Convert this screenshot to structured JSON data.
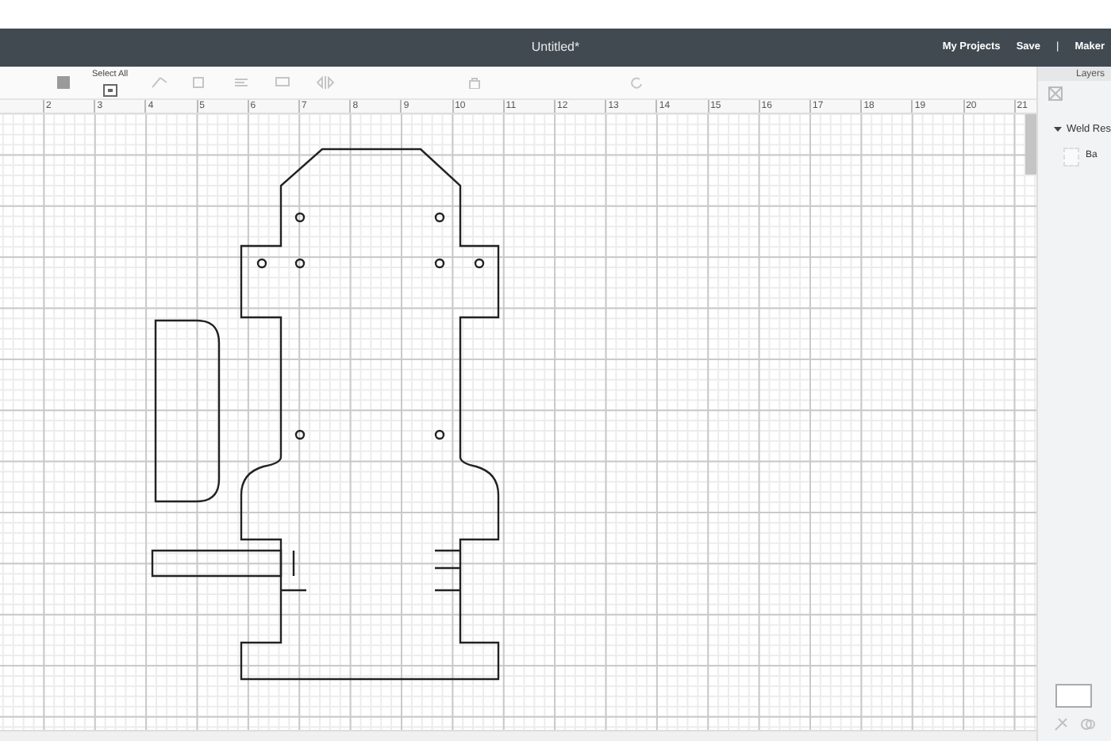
{
  "window": {
    "title": "Untitled*"
  },
  "header": {
    "items": [
      {
        "kind": "link",
        "label": "My Projects"
      },
      {
        "kind": "link",
        "label": "Save"
      },
      {
        "kind": "separator",
        "label": "|"
      },
      {
        "kind": "link",
        "label": "Maker"
      }
    ]
  },
  "toolbar": {
    "select_all": "Select All"
  },
  "ruler": {
    "labels": [
      "2",
      "3",
      "4",
      "5",
      "6",
      "7",
      "8",
      "9",
      "10",
      "11",
      "12",
      "13",
      "14",
      "15",
      "16",
      "17",
      "18",
      "19",
      "20",
      "21"
    ]
  },
  "layers_panel": {
    "title": "Layers",
    "groups": [
      {
        "label": "Weld Res",
        "expanded": true,
        "children": [
          {
            "label": "Ba"
          }
        ]
      }
    ]
  }
}
